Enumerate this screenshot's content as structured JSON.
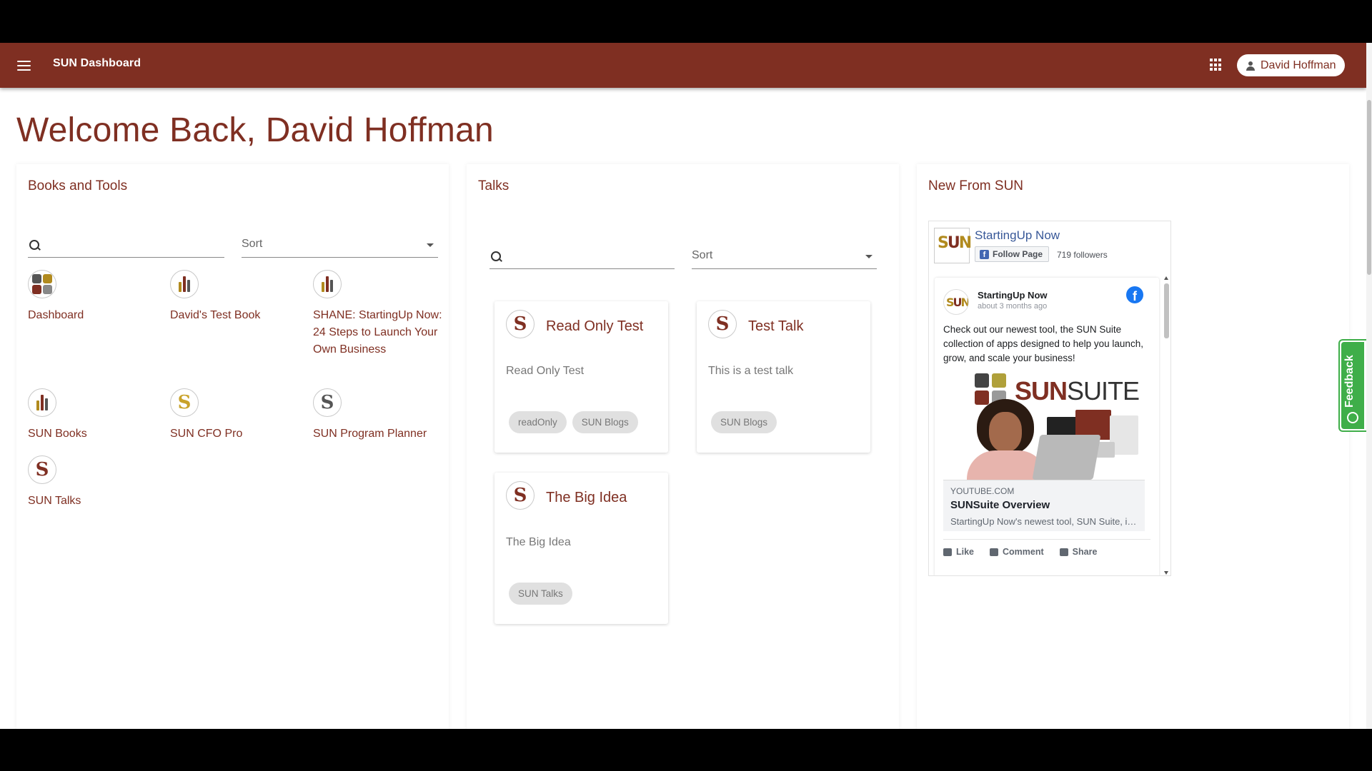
{
  "header": {
    "title": "SUN Dashboard",
    "user_name": "David Hoffman",
    "menu_icon": "hamburger-menu-icon",
    "apps_icon": "apps-grid-icon",
    "user_icon": "person-icon"
  },
  "welcome": "Welcome Back, David Hoffman",
  "books_and_tools": {
    "title": "Books and Tools",
    "search_placeholder": "",
    "sort_label": "Sort",
    "items": [
      {
        "label": "Dashboard",
        "icon": "dashboard-grid-icon"
      },
      {
        "label": "David's Test Book",
        "icon": "books-icon"
      },
      {
        "label": "SHANE: StartingUp Now: 24 Steps to Launch Your Own Business",
        "icon": "books-icon"
      },
      {
        "label": "SUN Books",
        "icon": "books-icon"
      },
      {
        "label": "SUN CFO Pro",
        "icon": "sun-s-gold-icon"
      },
      {
        "label": "SUN Program Planner",
        "icon": "sun-s-gray-icon"
      },
      {
        "label": "SUN Talks",
        "icon": "sun-s-red-icon"
      }
    ]
  },
  "talks": {
    "title": "Talks",
    "search_placeholder": "",
    "sort_label": "Sort",
    "cards": [
      {
        "title": "Read Only Test",
        "description": "Read Only Test",
        "tags": [
          "readOnly",
          "SUN Blogs"
        ]
      },
      {
        "title": "Test Talk",
        "description": "This is a test talk",
        "tags": [
          "SUN Blogs"
        ]
      },
      {
        "title": "The Big Idea",
        "description": "The Big Idea",
        "tags": [
          "SUN Talks"
        ]
      }
    ]
  },
  "new_from_sun": {
    "title": "New From SUN",
    "fb": {
      "page_name": "StartingUp Now",
      "follow_label": "Follow Page",
      "followers": "719 followers",
      "post": {
        "author": "StartingUp Now",
        "time": "about 3 months ago",
        "text": "Check out our newest tool, the SUN Suite collection of apps designed to help you launch, grow, and scale your business!",
        "media_brand_a": "SUN",
        "media_brand_b": "SUITE",
        "link_domain": "YOUTUBE.COM",
        "link_title": "SUNSuite Overview",
        "link_desc": "StartingUp Now's newest tool, SUN Suite, is a collection of apps",
        "actions": [
          "Like",
          "Comment",
          "Share"
        ]
      }
    }
  },
  "feedback_label": "Feedback",
  "colors": {
    "brand": "#7f2f22",
    "gold": "#b18a1e",
    "feedback_green": "#3fae49",
    "fb_blue": "#1877f2"
  }
}
